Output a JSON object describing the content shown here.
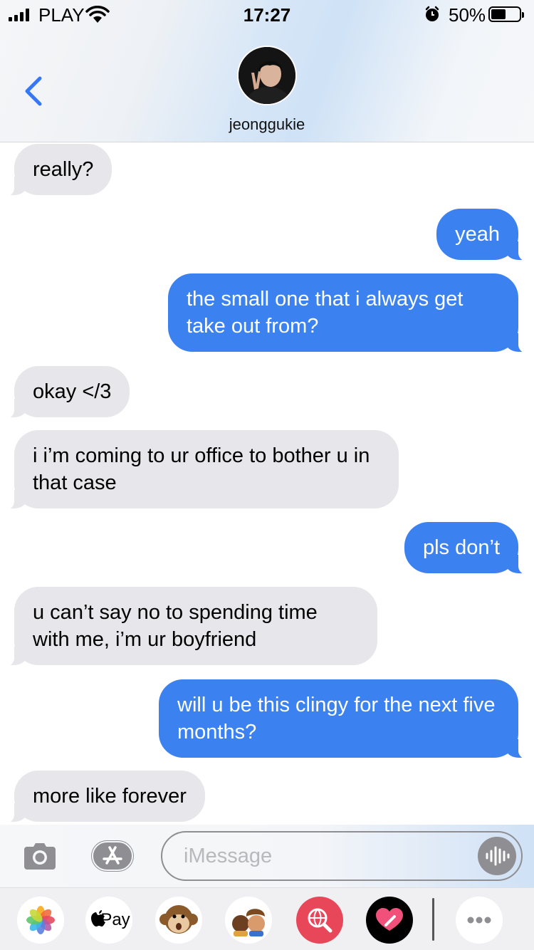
{
  "status_bar": {
    "carrier": "PLAY",
    "time": "17:27",
    "battery": "50%"
  },
  "header": {
    "contact_name": "jeonggukie"
  },
  "messages": [
    {
      "from": "them",
      "text": "really?"
    },
    {
      "from": "me",
      "text": "yeah"
    },
    {
      "from": "me",
      "text": "the small one that i always get take out from?"
    },
    {
      "from": "them",
      "text": "okay </3"
    },
    {
      "from": "them",
      "text": "i i’m coming to ur office to bother u in that case"
    },
    {
      "from": "me",
      "text": "pls don’t"
    },
    {
      "from": "them",
      "text": "u can’t say no to spending time with me, i’m ur boyfriend"
    },
    {
      "from": "me",
      "text": "will u be this clingy for the next five months?"
    },
    {
      "from": "them",
      "text": "more like forever"
    }
  ],
  "input": {
    "placeholder": "iMessage",
    "value": ""
  },
  "app_drawer": {
    "items": [
      "photos-app",
      "apple-pay-app",
      "animoji-app",
      "memoji-app",
      "web-search-app",
      "digital-touch-app",
      "more-apps"
    ],
    "apple_pay_label": "Pay"
  },
  "colors": {
    "outgoing_bubble": "#3b82f0",
    "incoming_bubble": "#e6e6eb",
    "accent": "#3478f6"
  }
}
